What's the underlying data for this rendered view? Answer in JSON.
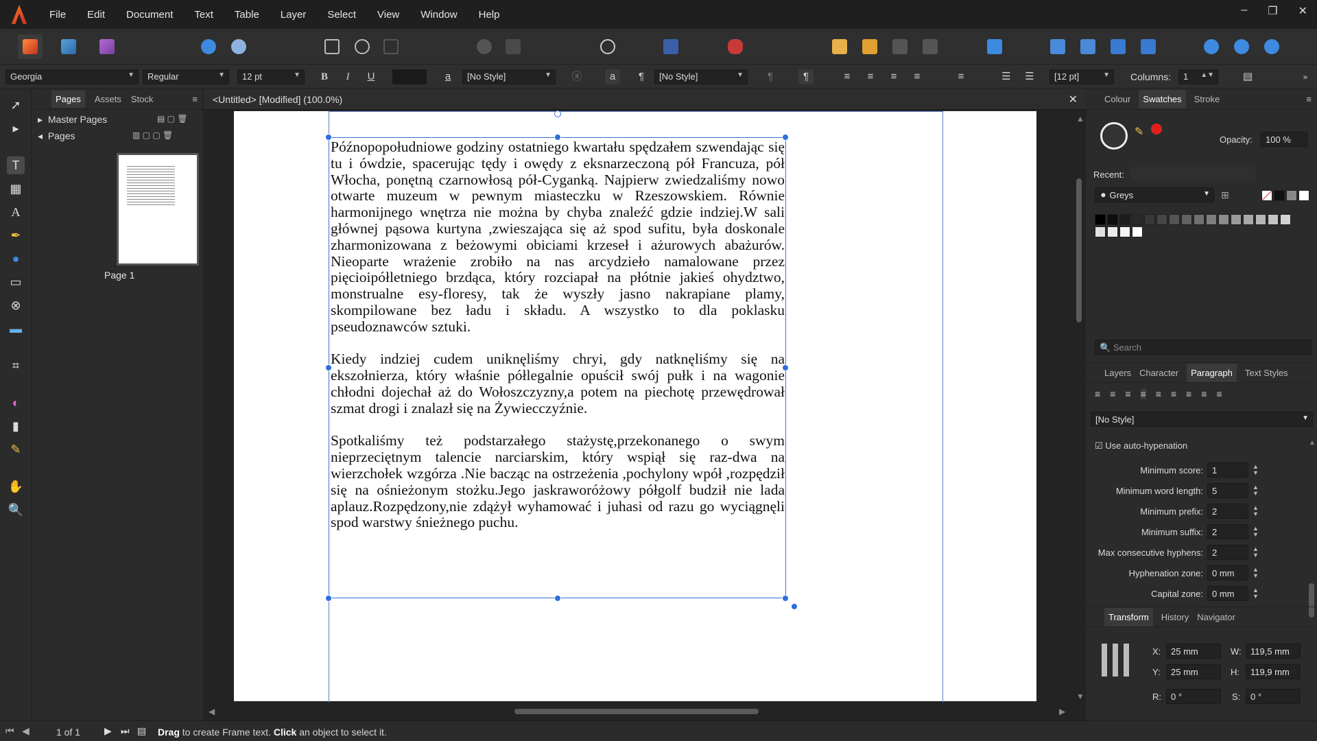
{
  "menu": [
    "File",
    "Edit",
    "Document",
    "Text",
    "Table",
    "Layer",
    "Select",
    "View",
    "Window",
    "Help"
  ],
  "context_bar": {
    "font_family": "Georgia",
    "font_style": "Regular",
    "font_size": "12 pt",
    "char_style": "[No Style]",
    "para_style": "[No Style]",
    "leading": "[12 pt]",
    "columns_label": "Columns:",
    "columns_value": "1"
  },
  "pages_panel": {
    "tabs": [
      "Pages",
      "Assets",
      "Stock"
    ],
    "master_pages": "Master Pages",
    "pages": "Pages",
    "page_label": "Page 1"
  },
  "document": {
    "tab_title": "<Untitled> [Modified] (100.0%)",
    "paragraphs": [
      "Późnopopołudniowe godziny ostatniego kwartału spędzałem szwendając się tu i ówdzie, spacerując tędy i owędy z eksnarzeczoną pół Francuza, pół Włocha, ponętną czarnowłosą pół-Cyganką. Najpierw zwiedzaliśmy nowo otwarte muzeum w pewnym miasteczku w Rzeszowskiem. Równie harmonijnego wnętrza nie można by chyba znaleźć gdzie indziej.W sali głównej pąsowa kurtyna ,zwieszająca się aż spod sufitu, była doskonale zharmonizowana z beżowymi obiciami krzeseł i ażurowych abażurów. Nieoparte wrażenie zrobiło na nas arcydzieło namalowane przez pięcioipółletniego brzdąca, który rozciapał na płótnie jakieś ohydztwo, monstrualne esy-floresy, tak że wyszły jasno nakrapiane plamy, skompilowane bez ładu i składu. A wszystko to dla poklasku pseudoznawców sztuki.",
      "Kiedy indziej cudem uniknęliśmy chryi, gdy natknęliśmy się na ekszołnierza, który właśnie półlegalnie opuścił swój pułk i na wagonie chłodni dojechał aż do Wołoszczyzny,a potem na piechotę przewędrował szmat drogi i znalazł się na Żywiecczyźnie.",
      "Spotkaliśmy też podstarzałego stażystę,przekonanego o swym nieprzeciętnym talencie narciarskim, który wspiął się raz-dwa na wierzchołek wzgórza .Nie bacząc na ostrzeżenia ,pochylony wpół ,rozpędził się na ośnieżonym stożku.Jego jaskraworóżowy półgolf budził nie lada aplauz.Rozpędzony,nie zdążył wyhamować i juhasi od razu go wyciągnęli spod warstwy śnieżnego puchu."
    ]
  },
  "right_panel": {
    "top_tabs": [
      "Colour",
      "Swatches",
      "Stroke"
    ],
    "opacity_label": "Opacity:",
    "opacity_value": "100 %",
    "recent_label": "Recent:",
    "palette": "Greys",
    "search_placeholder": "Search",
    "mid_tabs": [
      "Layers",
      "Character",
      "Paragraph",
      "Text Styles"
    ],
    "para_style": "[No Style]",
    "auto_hyphen_label": "Use auto-hypenation",
    "hyphen_fields": [
      {
        "label": "Minimum score:",
        "value": "1"
      },
      {
        "label": "Minimum word length:",
        "value": "5"
      },
      {
        "label": "Minimum prefix:",
        "value": "2"
      },
      {
        "label": "Minimum suffix:",
        "value": "2"
      },
      {
        "label": "Max consecutive hyphens:",
        "value": "2"
      },
      {
        "label": "Hyphenation zone:",
        "value": "0 mm"
      },
      {
        "label": "Capital zone:",
        "value": "0 mm"
      }
    ],
    "bottom_tabs": [
      "Transform",
      "History",
      "Navigator"
    ],
    "transform": {
      "x_label": "X:",
      "x": "25 mm",
      "y_label": "Y:",
      "y": "25 mm",
      "w_label": "W:",
      "w": "119,5 mm",
      "h_label": "H:",
      "h": "119,9 mm",
      "r_label": "R:",
      "r": "0 °",
      "s_label": "S:",
      "s": "0 °"
    }
  },
  "status": {
    "page_count": "1 of 1",
    "hint_bold1": "Drag",
    "hint_text1": " to create Frame text. ",
    "hint_bold2": "Click",
    "hint_text2": " an object to select it."
  },
  "colors": {
    "accent_blue": "#2f6ee0",
    "spellcheck_red": "#d23030",
    "brand_orange": "#ff7a2f"
  }
}
